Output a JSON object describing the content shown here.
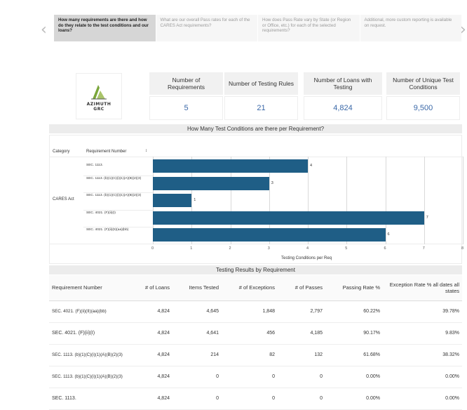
{
  "nav": {
    "prev_label": "‹",
    "next_label": "›",
    "tabs": [
      {
        "label": "How many requirements are there and how do they relate to the test conditions and our loans?",
        "active": true
      },
      {
        "label": "What are our overall Pass rates for each of the CARES Act requirements?",
        "active": false
      },
      {
        "label": "How does Pass Rate vary by State (or Region or Office, etc.) for each of the selected requirements?",
        "active": false
      },
      {
        "label": "Additional, more custom reporting is available on request.",
        "active": false
      }
    ]
  },
  "logo": {
    "line1": "AZIMUTH",
    "line2": "GRC"
  },
  "kpis": [
    {
      "label": "Number of Requirements",
      "value": "5"
    },
    {
      "label": "Number of Testing Rules",
      "value": "21"
    },
    {
      "label": "Number of Loans with Testing",
      "value": "4,824"
    },
    {
      "label": "Number of Unique Test Conditions",
      "value": "9,500"
    }
  ],
  "chart_data": {
    "type": "bar",
    "orientation": "horizontal",
    "title": "How Many Test Conditions are there per Requirement?",
    "header_category": "Category",
    "header_requirement": "Requirement Number",
    "sort_icon": "↕",
    "category": "CARES Act",
    "categories": [
      "SEC. 1113.",
      "SEC. 1113. (b)(1)(C)(i)(1)(A)(B)(2)(3)",
      "SEC. 1113. (b)(1)(C)(i)(1)(A)(B)(2)(3)",
      "SEC. 4021. (F)(ii)(I)",
      "SEC. 4021. (F)(ii)(II)(aa)(bb)"
    ],
    "values": [
      4,
      3,
      1,
      7,
      6
    ],
    "value_labels": [
      "4",
      "3",
      "1",
      "7",
      "6"
    ],
    "xlim": [
      0,
      8
    ],
    "x_ticks": [
      "0",
      "1",
      "2",
      "3",
      "4",
      "5",
      "6",
      "7",
      "8"
    ],
    "xlabel": "Testing Conditions per Req",
    "bar_color": "#1f5e86"
  },
  "table": {
    "title": "Testing Results by Requirement",
    "headers": [
      "Requirement Number",
      "# of Loans",
      "Items Tested",
      "# of Exceptions",
      "# of Passes",
      "Passing Rate %",
      "Exception Rate % all dates all states"
    ],
    "rows": [
      [
        "SEC. 4021. (F)(ii)(II)(aa)(bb)",
        "4,824",
        "4,645",
        "1,848",
        "2,797",
        "60.22%",
        "39.78%"
      ],
      [
        "SEC. 4021. (F)(ii)(I)",
        "4,824",
        "4,641",
        "456",
        "4,185",
        "90.17%",
        "9.83%"
      ],
      [
        "SEC. 1113. (b)(1)(C)(i)(1)(A)(B)(2)(3)",
        "4,824",
        "214",
        "82",
        "132",
        "61.68%",
        "38.32%"
      ],
      [
        "SEC. 1113. (b)(1)(C)(i)(1)(A)(B)(2)(3)",
        "4,824",
        "0",
        "0",
        "0",
        "0.00%",
        "0.00%"
      ],
      [
        "SEC. 1113.",
        "4,824",
        "0",
        "0",
        "0",
        "0.00%",
        "0.00%"
      ]
    ]
  }
}
